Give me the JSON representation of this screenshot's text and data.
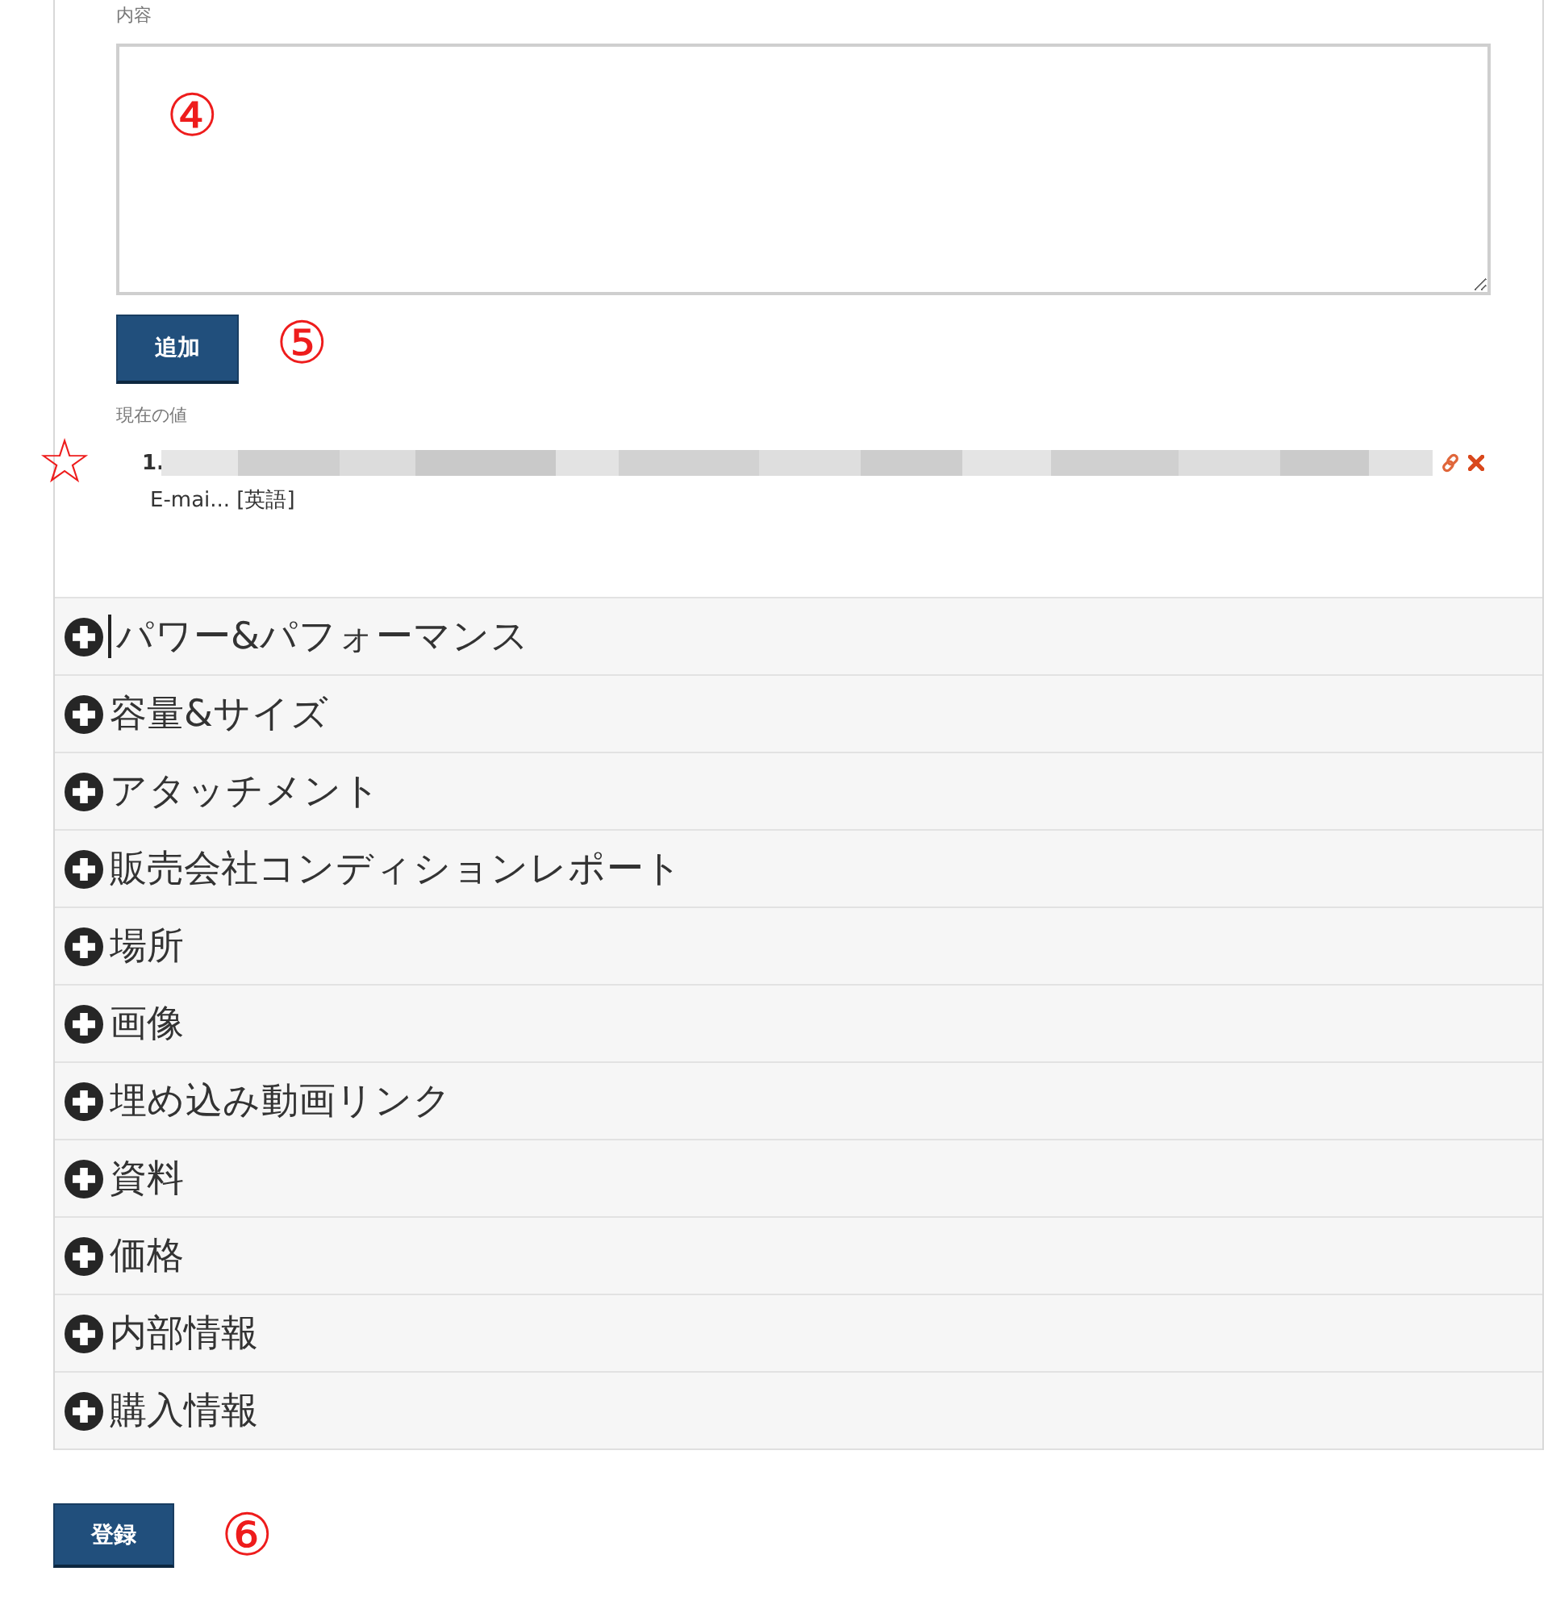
{
  "content_field": {
    "label": "内容",
    "annotation": "④"
  },
  "add_button": {
    "label": "追加",
    "annotation": "⑤"
  },
  "current_values": {
    "label": "現在の値",
    "items": [
      {
        "number": "1.",
        "redacted": true,
        "subtext": "E-mai... [英語]",
        "annotation": "☆"
      }
    ]
  },
  "sections": [
    {
      "title": "パワー&パフォーマンス",
      "expanded": false,
      "cursor": true
    },
    {
      "title": "容量&サイズ",
      "expanded": false,
      "cursor": false
    },
    {
      "title": "アタッチメント",
      "expanded": false,
      "cursor": false
    },
    {
      "title": "販売会社コンディションレポート",
      "expanded": false,
      "cursor": false
    },
    {
      "title": "場所",
      "expanded": false,
      "cursor": false
    },
    {
      "title": "画像",
      "expanded": false,
      "cursor": false
    },
    {
      "title": "埋め込み動画リンク",
      "expanded": false,
      "cursor": false
    },
    {
      "title": "資料",
      "expanded": false,
      "cursor": false
    },
    {
      "title": "価格",
      "expanded": false,
      "cursor": false
    },
    {
      "title": "内部情報",
      "expanded": false,
      "cursor": false
    },
    {
      "title": "購入情報",
      "expanded": false,
      "cursor": false
    }
  ],
  "submit_button": {
    "label": "登録",
    "annotation": "⑥"
  }
}
